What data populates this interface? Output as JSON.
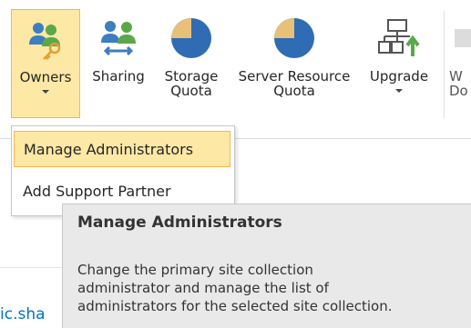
{
  "ribbon": {
    "owners": {
      "label": "Owners",
      "icon": "owners-icon"
    },
    "sharing": {
      "label": "Sharing",
      "icon": "sharing-icon"
    },
    "storage_quota": {
      "label_line1": "Storage",
      "label_line2": "Quota",
      "icon": "pie-chart-icon"
    },
    "server_resource_quota": {
      "label_line1": "Server Resource",
      "label_line2": "Quota",
      "icon": "pie-chart-icon"
    },
    "upgrade": {
      "label": "Upgrade",
      "icon": "upgrade-icon"
    },
    "cut_off": {
      "label_line1": "W",
      "label_line2": "Do"
    }
  },
  "owners_menu": {
    "items": [
      {
        "label": "Manage Administrators",
        "selected": true
      },
      {
        "label": "Add Support Partner",
        "selected": false
      }
    ]
  },
  "tooltip": {
    "title": "Manage Administrators",
    "body_line1": "Change the primary site collection",
    "body_line2": "administrator and manage the list of",
    "body_line3": "administrators for the selected site collection."
  },
  "background": {
    "link_fragment": "ic.sha"
  },
  "colors": {
    "selected_fill": "#fde8a5",
    "selected_border": "#f0b94b",
    "tooltip_bg": "#e9e9e9",
    "link": "#0072c6",
    "pie_blue": "#2f6cb3",
    "pie_tan": "#e8c07a",
    "green_accent": "#5aa84a"
  }
}
